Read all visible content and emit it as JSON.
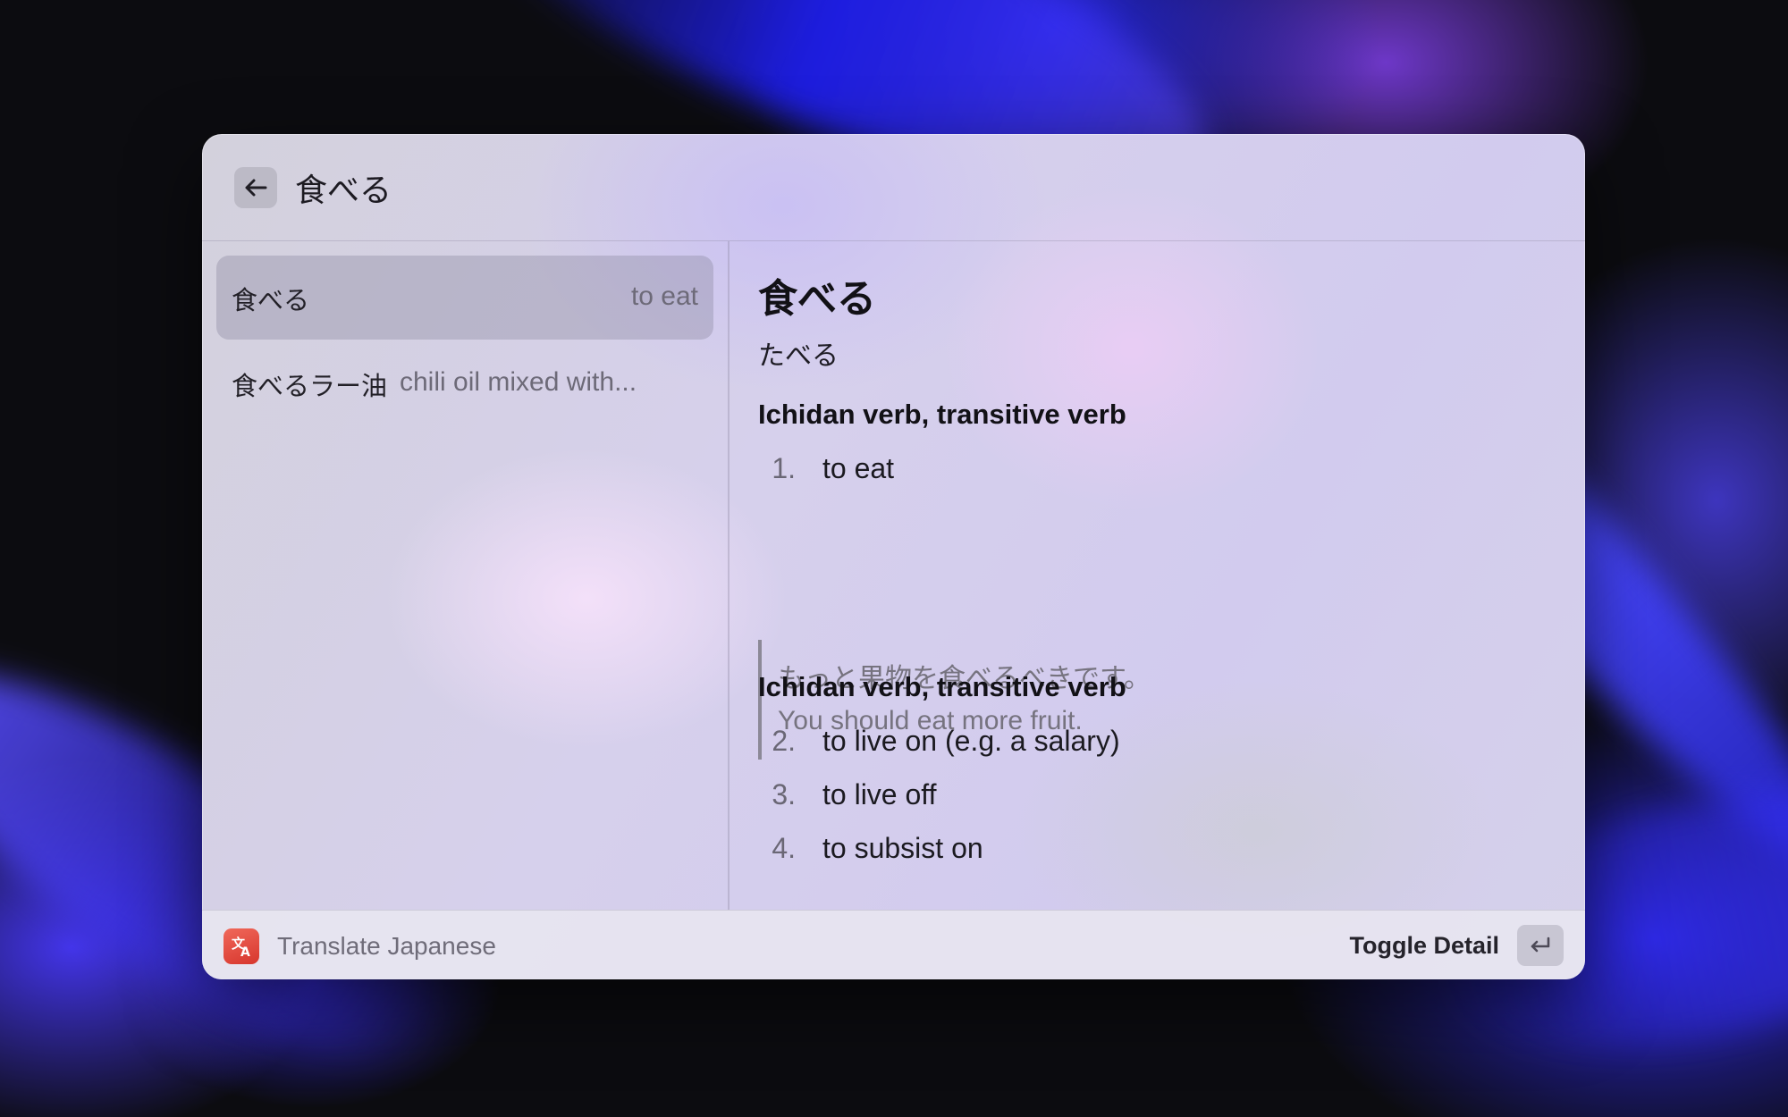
{
  "search": {
    "query": "食べる"
  },
  "results": [
    {
      "title": "食べる",
      "subtitle": "to eat",
      "selected": true
    },
    {
      "title": "食べるラー油",
      "subtitle": "chili oil mixed with...",
      "selected": false
    }
  ],
  "detail": {
    "headword": "食べる",
    "reading": "たべる",
    "sections": [
      {
        "pos": "Ichidan verb, transitive verb",
        "senses": [
          {
            "num": "1.",
            "gloss": "to eat"
          }
        ],
        "example": {
          "jp": "もっと果物を食べるべきです。",
          "en": "You should eat more fruit."
        }
      },
      {
        "pos": "Ichidan verb, transitive verb",
        "senses": [
          {
            "num": "2.",
            "gloss": "to live on (e.g. a salary)"
          },
          {
            "num": "3.",
            "gloss": "to live off"
          },
          {
            "num": "4.",
            "gloss": "to subsist on"
          }
        ]
      }
    ]
  },
  "action_bar": {
    "app_name": "Translate Japanese",
    "app_icon": "translate-icon",
    "app_icon_color": "#e2463a",
    "primary_action": "Toggle Detail",
    "shortcut_icon": "return-key-icon"
  }
}
